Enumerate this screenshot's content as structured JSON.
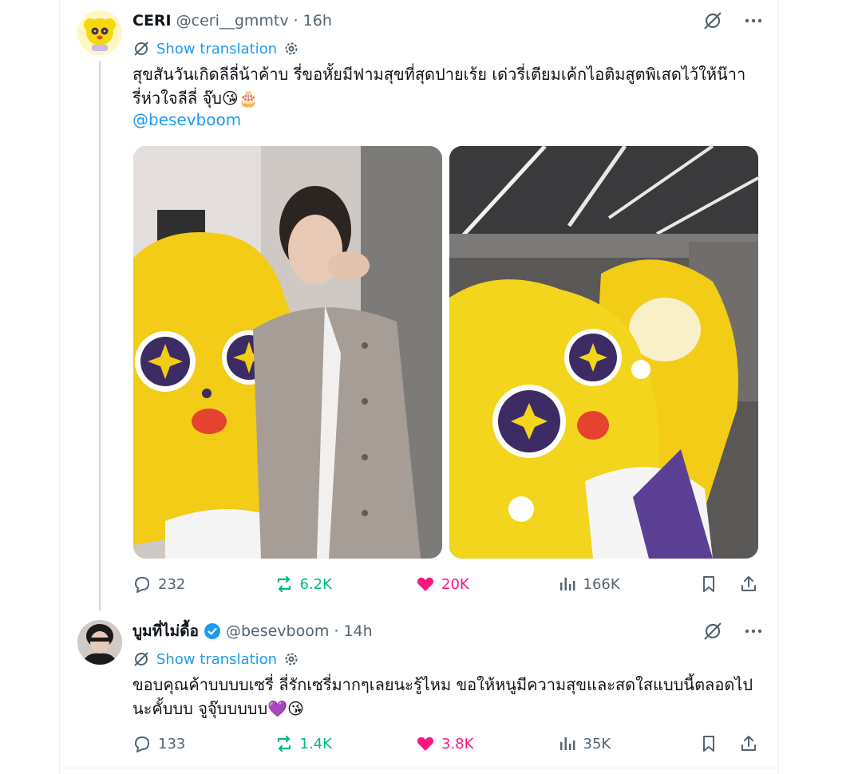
{
  "tweets": [
    {
      "name": "CERI",
      "handle": "@ceri__gmmtv",
      "time": "16h",
      "show_translation": "Show translation",
      "text_line1": "สุขสันวันเกิดลีลี่น้าค้าบ รี่ขอหั้ยมีฟามสุขที่สุดปายเร้ย เด่วรี่เตียมเค้กไอติมสูตพิเสดไว้ให้น๊าา",
      "text_line2": "รี่ห่วใจลีลี่ จุ๊บ😘🎂",
      "mention": "@besevboom",
      "actions": {
        "replies": "232",
        "reposts": "6.2K",
        "likes": "20K",
        "views": "166K"
      }
    },
    {
      "name": "บูมที่ไม่ดื้อ",
      "handle": "@besevboom",
      "time": "14h",
      "show_translation": "Show translation",
      "text_line1": "ขอบคุณค้าบบบบเซรี่ ลี่รักเซรี่มากๆเลยนะรู้ไหม ขอให้หนูมีความสุขและสดใสแบบนี้ตลอดไป",
      "text_line2": "นะคั้บบบ จูจุ๊บบบบบ💜😘",
      "actions": {
        "replies": "133",
        "reposts": "1.4K",
        "likes": "3.8K",
        "views": "35K"
      }
    }
  ],
  "colors": {
    "accent": "#1d9bf0",
    "repost": "#00ba7c",
    "like": "#f91880",
    "muted": "#536471",
    "mascot_yellow": "#f5d90a"
  },
  "icons": [
    "grok-icon",
    "more-icon",
    "translate-icon",
    "settings-icon",
    "reply-icon",
    "repost-icon",
    "heart-icon",
    "views-icon",
    "bookmark-icon",
    "share-icon",
    "verified-icon"
  ]
}
